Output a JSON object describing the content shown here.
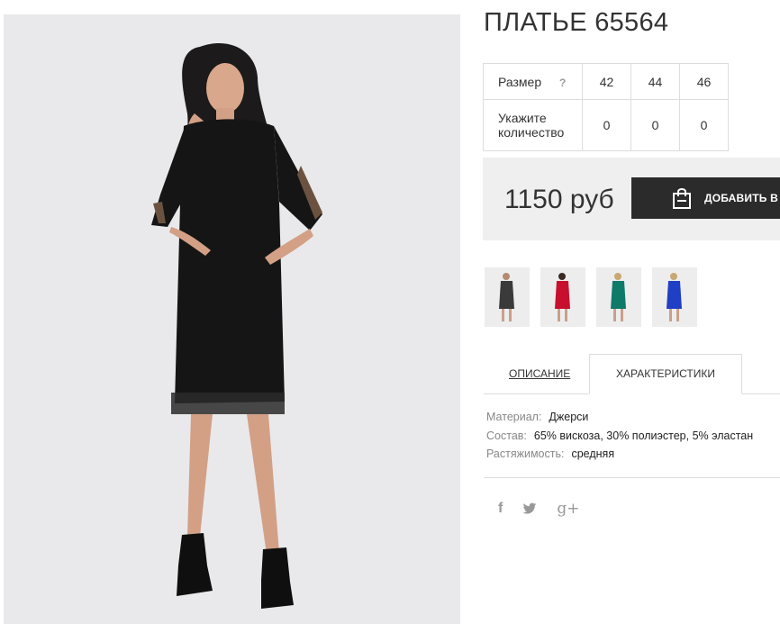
{
  "product": {
    "title": "ПЛАТЬЕ 65564",
    "main_image_icon": "model-in-black-dress-photo"
  },
  "size_table": {
    "size_label": "Размер",
    "help_mark": "?",
    "quantity_label": "Укажите количество",
    "sizes": [
      "42",
      "44",
      "46"
    ],
    "quantities": [
      "0",
      "0",
      "0"
    ]
  },
  "purchase": {
    "price": "1150 руб",
    "add_to_cart_label": "ДОБАВИТЬ В КОРЗИНУ",
    "button_icon": "shopping-bag-icon"
  },
  "color_variants": [
    {
      "color": "#3a3a3a",
      "name": "black"
    },
    {
      "color": "#c8102e",
      "name": "red"
    },
    {
      "color": "#0f7a6a",
      "name": "green"
    },
    {
      "color": "#1f3fc4",
      "name": "blue"
    }
  ],
  "tabs": {
    "description": "ОПИСАНИЕ",
    "characteristics": "ХАРАКТЕРИСТИКИ",
    "active": "characteristics"
  },
  "characteristics": [
    {
      "key": "Материал:",
      "value": "Джерси"
    },
    {
      "key": "Состав:",
      "value": "65% вискоза, 30% полиэстер, 5% эластан"
    },
    {
      "key": "Растяжимость:",
      "value": "средняя"
    }
  ],
  "social": {
    "facebook": "f",
    "twitter_icon": "twitter-bird-icon",
    "google_plus": "g+"
  },
  "colors": {
    "button_bg": "#2b2b2b",
    "price_box_bg": "#efefef",
    "photo_bg": "#e9e9eb"
  }
}
